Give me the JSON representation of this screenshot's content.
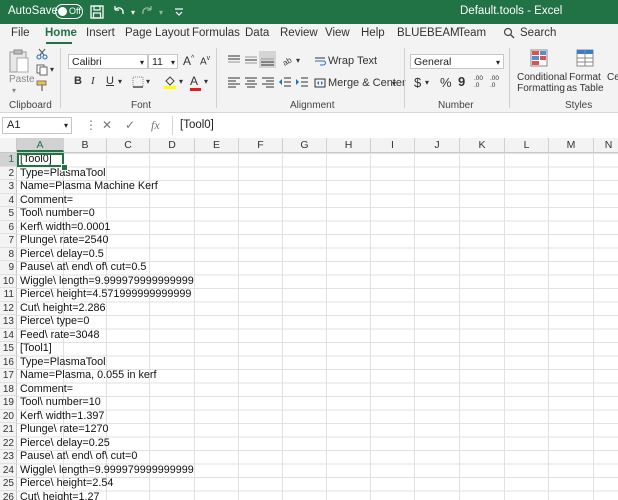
{
  "titlebar": {
    "autosave_label": "AutoSave",
    "autosave_state": "Off",
    "document_title": "Default.tools  -  Excel",
    "bg_color": "#217346"
  },
  "menu": [
    "File",
    "Home",
    "Insert",
    "Page Layout",
    "Formulas",
    "Data",
    "Review",
    "View",
    "Help",
    "BLUEBEAM",
    "Team"
  ],
  "menu_active": "Home",
  "search_label": "Search",
  "ribbon": {
    "clipboard": {
      "label": "Clipboard",
      "paste": "Paste"
    },
    "font": {
      "label": "Font",
      "name": "Calibri",
      "size": "11"
    },
    "alignment": {
      "label": "Alignment",
      "wrap": "Wrap Text",
      "merge": "Merge & Center"
    },
    "number": {
      "label": "Number",
      "format": "General",
      "currency": "$",
      "percent": "%",
      "comma": "9",
      "inc_decimal": ".00 .0",
      "dec_decimal": ".00 .0"
    },
    "styles": {
      "label": "Styles",
      "conditional": "Conditional Formatting",
      "format_table": "Format as Table",
      "cell_styles": "Cell Styles"
    }
  },
  "formula_bar": {
    "name_box": "A1",
    "fx": "fx",
    "content": "[Tool0]"
  },
  "columns": [
    "A",
    "B",
    "C",
    "D",
    "E",
    "F",
    "G",
    "H",
    "I",
    "J",
    "K",
    "L",
    "M",
    "N"
  ],
  "rows": [
    {
      "n": "1",
      "a": "[Tool0]"
    },
    {
      "n": "2",
      "a": "Type=PlasmaTool"
    },
    {
      "n": "3",
      "a": "Name=Plasma Machine Kerf"
    },
    {
      "n": "4",
      "a": "Comment="
    },
    {
      "n": "5",
      "a": "Tool\\ number=0"
    },
    {
      "n": "6",
      "a": "Kerf\\ width=0.0001"
    },
    {
      "n": "7",
      "a": "Plunge\\ rate=2540"
    },
    {
      "n": "8",
      "a": "Pierce\\ delay=0.5"
    },
    {
      "n": "9",
      "a": "Pause\\ at\\ end\\ of\\ cut=0.5"
    },
    {
      "n": "10",
      "a": "Wiggle\\ length=9.999979999999999"
    },
    {
      "n": "11",
      "a": "Pierce\\ height=4.571999999999999"
    },
    {
      "n": "12",
      "a": "Cut\\ height=2.286"
    },
    {
      "n": "13",
      "a": "Pierce\\ type=0"
    },
    {
      "n": "14",
      "a": "Feed\\ rate=3048"
    },
    {
      "n": "15",
      "a": "[Tool1]"
    },
    {
      "n": "16",
      "a": "Type=PlasmaTool"
    },
    {
      "n": "17",
      "a": "Name=Plasma, 0.055 in kerf"
    },
    {
      "n": "18",
      "a": "Comment="
    },
    {
      "n": "19",
      "a": "Tool\\ number=10"
    },
    {
      "n": "20",
      "a": "Kerf\\ width=1.397"
    },
    {
      "n": "21",
      "a": "Plunge\\ rate=1270"
    },
    {
      "n": "22",
      "a": "Pierce\\ delay=0.25"
    },
    {
      "n": "23",
      "a": "Pause\\ at\\ end\\ of\\ cut=0"
    },
    {
      "n": "24",
      "a": "Wiggle\\ length=9.999979999999999"
    },
    {
      "n": "25",
      "a": "Pierce\\ height=2.54"
    },
    {
      "n": "26",
      "a": "Cut\\ height=1.27"
    }
  ]
}
